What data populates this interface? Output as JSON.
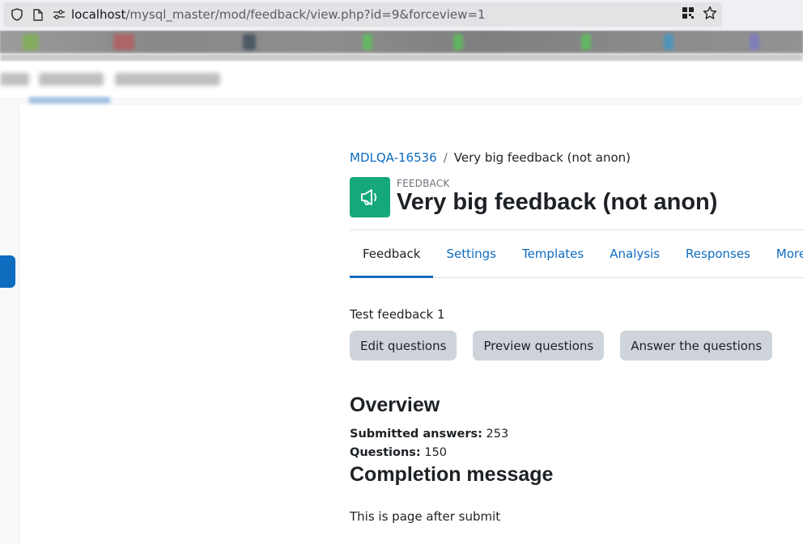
{
  "browser": {
    "url_host": "localhost",
    "url_path": "/mysql_master/mod/feedback/view.php?id=9&forceview=1"
  },
  "breadcrumb": {
    "course": "MDLQA-16536",
    "separator": "/",
    "current": "Very big feedback (not anon)"
  },
  "activity": {
    "type_label": "FEEDBACK",
    "title": "Very big feedback (not anon)",
    "icon": "megaphone-icon",
    "icon_color": "#15a87b"
  },
  "tabs": [
    {
      "label": "Feedback",
      "active": true
    },
    {
      "label": "Settings"
    },
    {
      "label": "Templates"
    },
    {
      "label": "Analysis"
    },
    {
      "label": "Responses"
    },
    {
      "label": "More"
    }
  ],
  "intro": "Test feedback 1",
  "buttons": {
    "edit": "Edit questions",
    "preview": "Preview questions",
    "answer": "Answer the questions"
  },
  "overview": {
    "heading": "Overview",
    "submitted_label": "Submitted answers:",
    "submitted_value": "253",
    "questions_label": "Questions:",
    "questions_value": "150"
  },
  "completion": {
    "heading": "Completion message",
    "text": "This is page after submit"
  },
  "colors": {
    "link": "#0f6cbf",
    "button_bg": "#ced4da"
  }
}
